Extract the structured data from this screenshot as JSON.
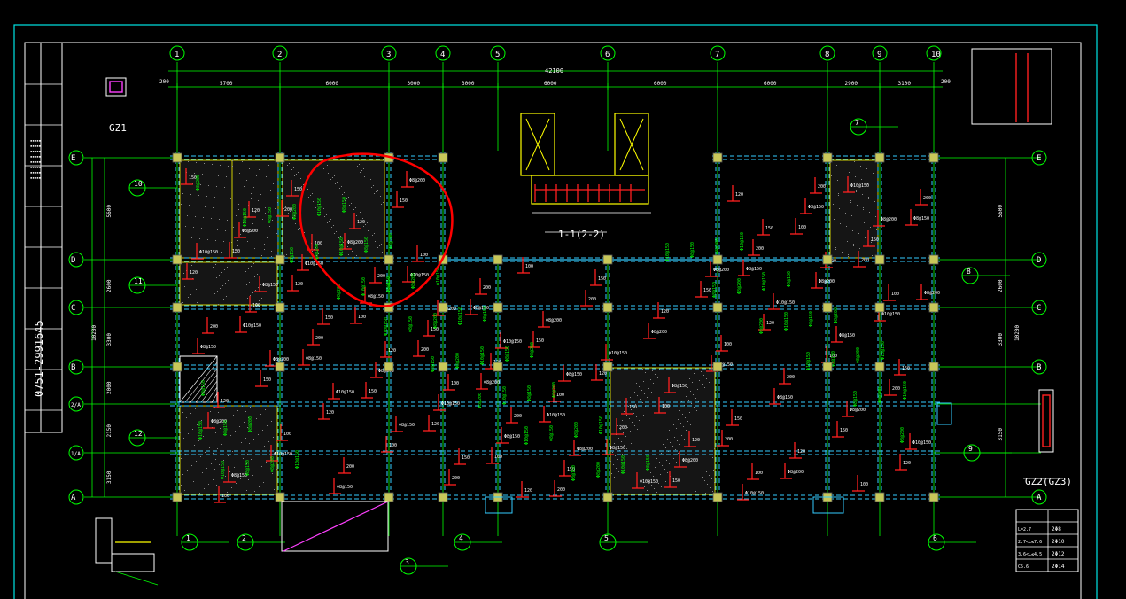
{
  "colors": {
    "background": "#000000",
    "grid": "#00ff00",
    "beam": "#33ccff",
    "slab_rebar": "#ff2020",
    "column": "#c8c85a",
    "frame": "#00e5e5",
    "white": "#ffffff",
    "yellow": "#ffff00",
    "magenta": "#ff40ff",
    "annotation": "#ff0000"
  },
  "axes_top": [
    "1",
    "2",
    "3",
    "4",
    "5",
    "6",
    "7",
    "8",
    "9",
    "10"
  ],
  "axes_left": [
    "E",
    "D",
    "C",
    "B",
    "2/A",
    "1/A",
    "A"
  ],
  "axes_right": [
    "E",
    "D",
    "C",
    "B",
    "A"
  ],
  "dims_top": [
    "5700",
    "6000",
    "3000",
    "3000",
    "6000",
    "6000",
    "6000",
    "2900",
    "3100"
  ],
  "dim_overall_top": "42100",
  "dim_edge": "200",
  "dims_left": [
    "5600",
    "2600",
    "3300",
    "2000",
    "2150",
    "3150"
  ],
  "dim_total_left": "10200",
  "dims_right": [
    "5600",
    "2600",
    "3300",
    "3150"
  ],
  "dim_total_right": "10200",
  "title_strip": {
    "phone": "0751-2991645"
  },
  "details": {
    "gz1": "GZ1",
    "gz2": "GZ2(GZ3)",
    "section_label": "1-1(2-2)",
    "column_table": {
      "rows": [
        {
          "a": "L=2.7",
          "b": "2Φ8"
        },
        {
          "a": "2.7<L≤7.6",
          "b": "2Φ10"
        },
        {
          "a": "3.6<L≤4.5",
          "b": "2Φ12"
        },
        {
          "a": "C5.6",
          "b": "2Φ14"
        }
      ]
    }
  },
  "detail_callouts": [
    "10",
    "11",
    "12",
    "1",
    "2",
    "3",
    "4",
    "5",
    "6",
    "7",
    "8",
    "9"
  ],
  "slab_labels": [
    "150",
    "120",
    "100",
    "200",
    "Φ8@200",
    "Φ10@150",
    "Φ8@150"
  ],
  "annotation": "red-hand-drawn-circle"
}
